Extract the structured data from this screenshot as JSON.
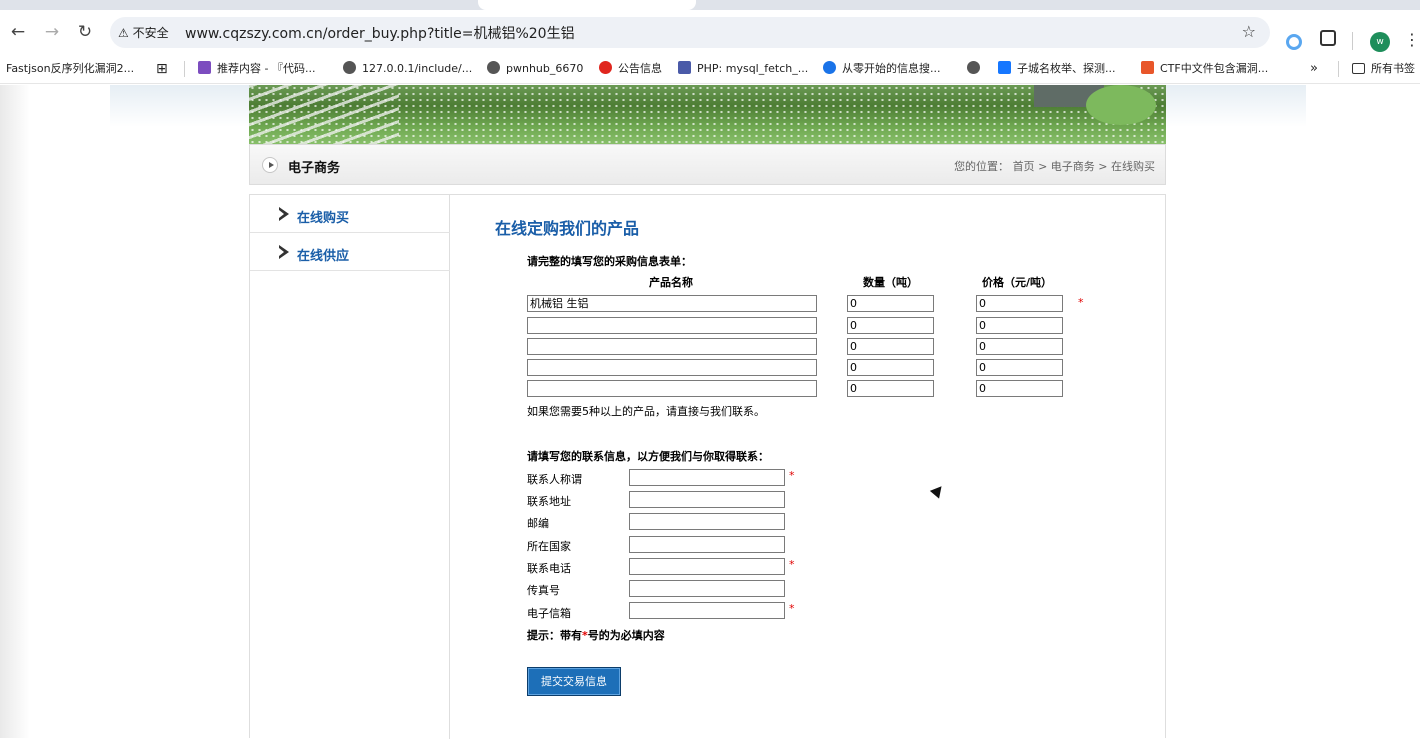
{
  "browser": {
    "security_label": "不安全",
    "url": "www.cqzszy.com.cn/order_buy.php?title=机械铝%20生铝",
    "profile_initial": "w",
    "bookmarks": [
      "Fastjson反序列化漏洞2...",
      "推荐内容 - 『代码...",
      "127.0.0.1/include/...",
      "pwnhub_6670",
      "公告信息",
      "PHP: mysql_fetch_...",
      "从零开始的信息搜...",
      "子城名枚举、探测...",
      "CTF中文件包含漏洞...",
      "»",
      "所有书签"
    ]
  },
  "page": {
    "section_title": "电子商务",
    "breadcrumb": {
      "prefix": "您的位置：",
      "home": "首页",
      "sep": ">",
      "level1": "电子商务",
      "current": "在线购买"
    },
    "sidebar": [
      {
        "label": "在线购买"
      },
      {
        "label": "在线供应"
      }
    ],
    "main_title": "在线定购我们的产品",
    "form": {
      "intro": "请完整的填写您的采购信息表单：",
      "col_product": "产品名称",
      "col_qty": "数量（吨）",
      "col_price": "价格（元/吨）",
      "rows": [
        {
          "product": "机械铝 生铝",
          "qty": "0",
          "price": "0"
        },
        {
          "product": "",
          "qty": "0",
          "price": "0"
        },
        {
          "product": "",
          "qty": "0",
          "price": "0"
        },
        {
          "product": "",
          "qty": "0",
          "price": "0"
        },
        {
          "product": "",
          "qty": "0",
          "price": "0"
        }
      ],
      "more_note": "如果您需要5种以上的产品，请直接与我们联系。",
      "contact_intro": "请填写您的联系信息，以方便我们与你取得联系：",
      "fields": {
        "name": "联系人称谓",
        "address": "联系地址",
        "zip": "邮编",
        "country": "所在国家",
        "phone": "联系电话",
        "fax": "传真号",
        "email": "电子信箱"
      },
      "required_mark": "*",
      "tip_prefix": "提示：带有",
      "tip_suffix": "号的为必填内容",
      "submit_label": "提交交易信息"
    }
  },
  "colors": {
    "link_blue": "#1a5ea8",
    "submit_blue": "#1d6fb8",
    "required_red": "#e00000"
  }
}
